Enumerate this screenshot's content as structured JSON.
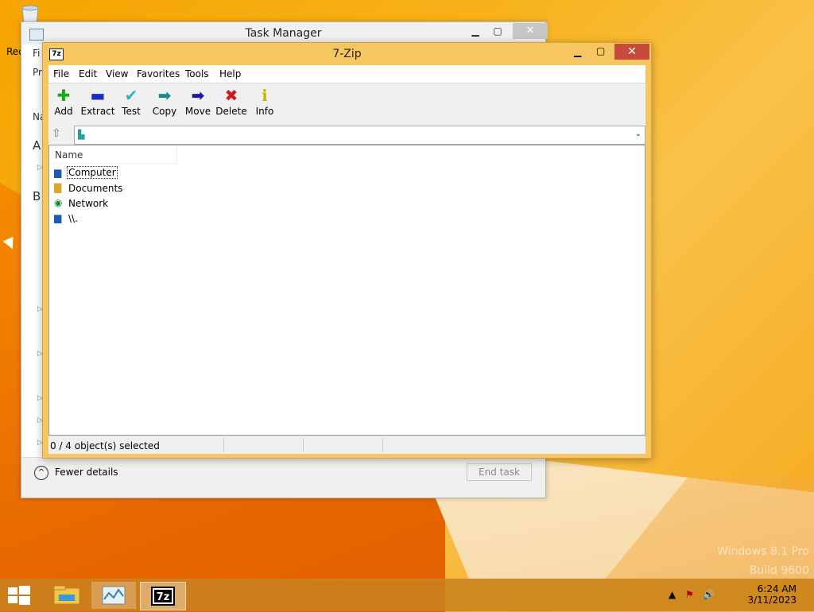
{
  "desktop": {
    "recycle_label": "Rec",
    "watermark_line1": "Windows 8.1 Pro",
    "watermark_line2": "Build 9600"
  },
  "task_manager": {
    "title": "Task Manager",
    "menu_partial": "Fi",
    "tab_partial": "Pr",
    "col_partial": "Na",
    "group_a": "A",
    "group_b": "B",
    "fewer_details": "Fewer details",
    "end_task": "End task"
  },
  "sevenzip": {
    "title": "7-Zip",
    "menu": [
      "File",
      "Edit",
      "View",
      "Favorites",
      "Tools",
      "Help"
    ],
    "toolbar": [
      {
        "label": "Add",
        "icon": "plus-icon",
        "color": "#1aa81a"
      },
      {
        "label": "Extract",
        "icon": "minus-icon",
        "color": "#1a2fbf"
      },
      {
        "label": "Test",
        "icon": "check-icon",
        "color": "#2bb5b5"
      },
      {
        "label": "Copy",
        "icon": "arrow-right-icon",
        "color": "#1a8a8a"
      },
      {
        "label": "Move",
        "icon": "arrow-right-icon",
        "color": "#1a1a9a"
      },
      {
        "label": "Delete",
        "icon": "x-icon",
        "color": "#d01a1a"
      },
      {
        "label": "Info",
        "icon": "info-icon",
        "color": "#c8b400"
      }
    ],
    "address_value": "",
    "column_name": "Name",
    "rows": [
      {
        "name": "Computer",
        "icon": "computer-icon",
        "selected": true
      },
      {
        "name": "Documents",
        "icon": "folder-icon",
        "selected": false
      },
      {
        "name": "Network",
        "icon": "network-icon",
        "selected": false
      },
      {
        "name": "\\\\.",
        "icon": "computer-icon",
        "selected": false
      }
    ],
    "status": "0 / 4 object(s) selected"
  },
  "taskbar": {
    "time": "6:24 AM",
    "date": "3/11/2023"
  }
}
